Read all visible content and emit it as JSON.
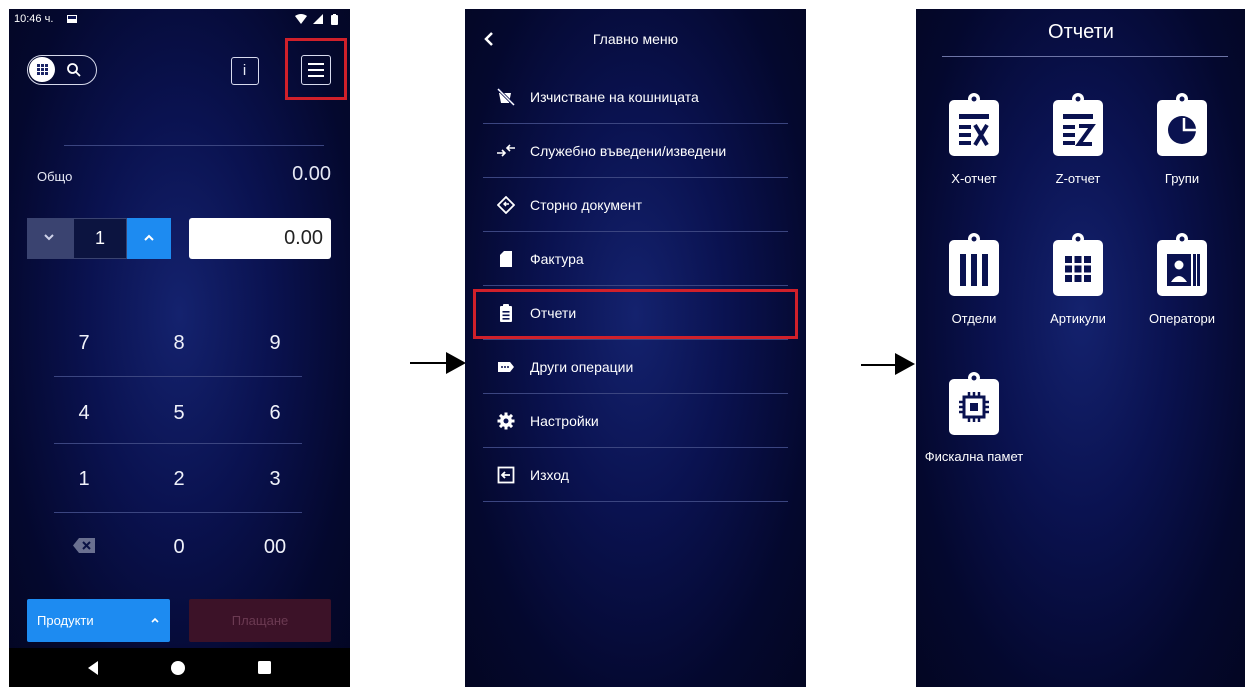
{
  "screen1": {
    "status_time": "10:46 ч.",
    "total_label": "Общо",
    "total_value": "0.00",
    "quantity": "1",
    "price": "0.00",
    "keys": [
      "7",
      "8",
      "9",
      "4",
      "5",
      "6",
      "1",
      "2",
      "3",
      "0",
      "00"
    ],
    "products_button": "Продукти",
    "pay_button": "Плащане",
    "info_button_glyph": "i"
  },
  "screen2": {
    "title": "Главно меню",
    "items": [
      {
        "label": "Изчистване на кошницата",
        "icon": "clear-cart-icon"
      },
      {
        "label": "Служебно въведени/изведени",
        "icon": "transfer-icon"
      },
      {
        "label": "Сторно документ",
        "icon": "storno-icon"
      },
      {
        "label": "Фактура",
        "icon": "invoice-icon"
      },
      {
        "label": "Отчети",
        "icon": "clipboard-icon"
      },
      {
        "label": "Други операции",
        "icon": "more-icon"
      },
      {
        "label": "Настройки",
        "icon": "gear-icon"
      },
      {
        "label": "Изход",
        "icon": "exit-icon"
      }
    ]
  },
  "screen3": {
    "title": "Отчети",
    "reports": [
      {
        "label": "Х-отчет",
        "icon": "x-report-icon"
      },
      {
        "label": "Z-отчет",
        "icon": "z-report-icon"
      },
      {
        "label": "Групи",
        "icon": "groups-icon"
      },
      {
        "label": "Отдели",
        "icon": "departments-icon"
      },
      {
        "label": "Артикули",
        "icon": "articles-icon"
      },
      {
        "label": "Оператори",
        "icon": "operators-icon"
      },
      {
        "label": "Фискална памет",
        "icon": "fiscal-memory-icon"
      }
    ]
  },
  "colors": {
    "highlight": "#d0202a",
    "accent_blue": "#1d8bf1",
    "background_dark": "#060b38"
  }
}
